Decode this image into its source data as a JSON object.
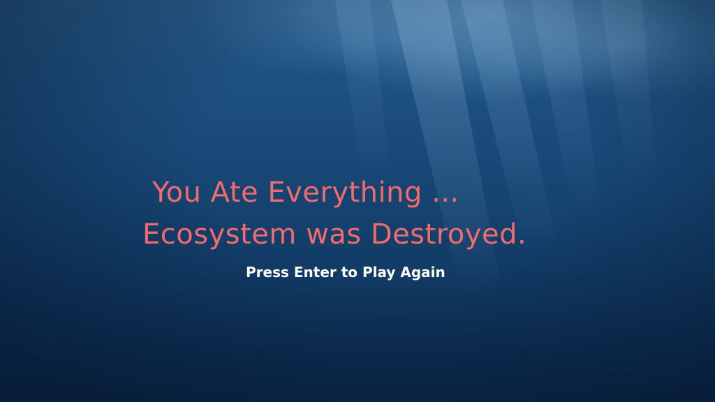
{
  "game_over": {
    "title_line_1": "You Ate Everything ...",
    "title_line_2": "Ecosystem was Destroyed.",
    "prompt": "Press Enter to Play Again"
  },
  "colors": {
    "title": "#f06b6b",
    "prompt": "#ffffff",
    "water_deep": "#0b2a4c",
    "water_light": "#2a5f8e"
  }
}
